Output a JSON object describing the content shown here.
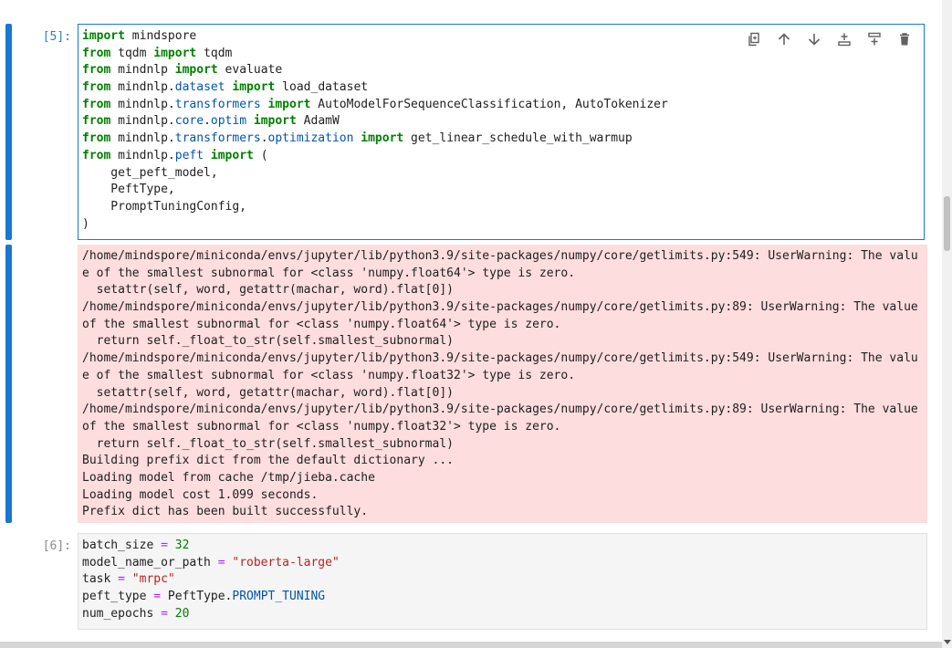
{
  "partial_top_line": "                    ───  ─────────  ────────────────  ─  ──────",
  "cells": [
    {
      "prompt": "[5]:",
      "toolbar": {
        "duplicate": "duplicate-icon",
        "move_up": "arrow-up-icon",
        "move_down": "arrow-down-icon",
        "insert_above": "insert-above-icon",
        "insert_below": "insert-below-icon",
        "delete": "trash-icon"
      }
    },
    {
      "prompt": "[6]:"
    }
  ],
  "stderr_lines": [
    "/home/mindspore/miniconda/envs/jupyter/lib/python3.9/site-packages/numpy/core/getlimits.py:549: UserWarning: The valu",
    "e of the smallest subnormal for <class 'numpy.float64'> type is zero.",
    "  setattr(self, word, getattr(machar, word).flat[0])",
    "/home/mindspore/miniconda/envs/jupyter/lib/python3.9/site-packages/numpy/core/getlimits.py:89: UserWarning: The value",
    "of the smallest subnormal for <class 'numpy.float64'> type is zero.",
    "  return self._float_to_str(self.smallest_subnormal)",
    "/home/mindspore/miniconda/envs/jupyter/lib/python3.9/site-packages/numpy/core/getlimits.py:549: UserWarning: The valu",
    "e of the smallest subnormal for <class 'numpy.float32'> type is zero.",
    "  setattr(self, word, getattr(machar, word).flat[0])",
    "/home/mindspore/miniconda/envs/jupyter/lib/python3.9/site-packages/numpy/core/getlimits.py:89: UserWarning: The value",
    "of the smallest subnormal for <class 'numpy.float32'> type is zero.",
    "  return self._float_to_str(self.smallest_subnormal)",
    "Building prefix dict from the default dictionary ...",
    "Loading model from cache /tmp/jieba.cache",
    "Loading model cost 1.099 seconds.",
    "Prefix dict has been built successfully."
  ],
  "code5": {
    "l1": [
      "import",
      " mindspore"
    ],
    "l2": [
      "from",
      " tqdm ",
      "import",
      " tqdm"
    ],
    "l3": [
      "from",
      " mindnlp ",
      "import",
      " evaluate"
    ],
    "l4": [
      "from",
      " mindnlp.",
      "dataset",
      " ",
      "import",
      " load_dataset"
    ],
    "l5": [
      "from",
      " mindnlp.",
      "transformers",
      " ",
      "import",
      " AutoModelForSequenceClassification, AutoTokenizer"
    ],
    "l6": [
      "from",
      " mindnlp.",
      "core",
      ".",
      "optim",
      " ",
      "import",
      " AdamW"
    ],
    "l7": [
      "from",
      " mindnlp.",
      "transformers",
      ".",
      "optimization",
      " ",
      "import",
      " get_linear_schedule_with_warmup"
    ],
    "l8": [
      "from",
      " mindnlp.",
      "peft",
      " ",
      "import",
      " ("
    ],
    "l9": "    get_peft_model,",
    "l10": "    PeftType,",
    "l11": "    PromptTuningConfig,",
    "l12": ")"
  },
  "code6": {
    "l1": [
      "batch_size ",
      "=",
      " ",
      "32"
    ],
    "l2": [
      "model_name_or_path ",
      "=",
      " ",
      "\"roberta-large\""
    ],
    "l3": [
      "task ",
      "=",
      " ",
      "\"mrpc\""
    ],
    "l4": [
      "peft_type ",
      "=",
      " PeftType.",
      "PROMPT_TUNING"
    ],
    "l5": [
      "num_epochs ",
      "=",
      " ",
      "20"
    ]
  }
}
